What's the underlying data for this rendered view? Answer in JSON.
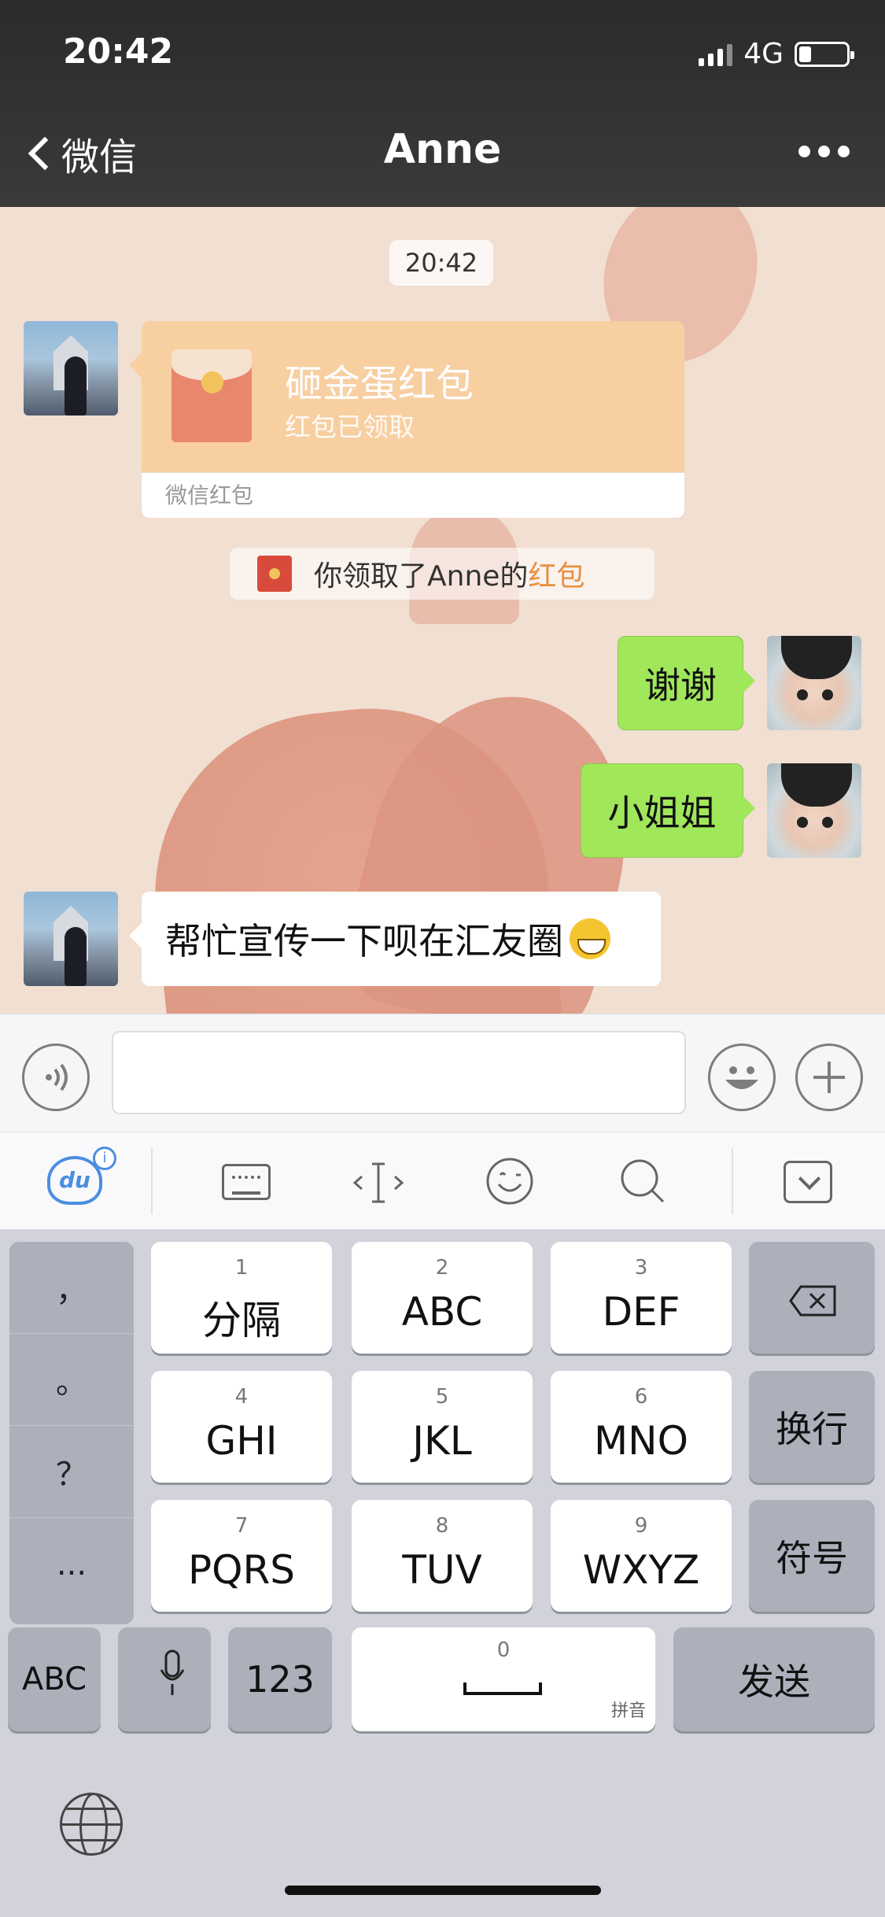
{
  "status_bar": {
    "time": "20:42",
    "network": "4G",
    "battery_level": 0.25
  },
  "nav": {
    "back_label": "微信",
    "title": "Anne"
  },
  "chat": {
    "timestamp": "20:42",
    "red_packet": {
      "title": "砸金蛋红包",
      "status": "红包已领取",
      "footer": "微信红包"
    },
    "system_notice": {
      "text": "你领取了Anne的",
      "link": "红包"
    },
    "messages": [
      {
        "side": "right",
        "text": "谢谢"
      },
      {
        "side": "right",
        "text": "小姐姐"
      },
      {
        "side": "left",
        "text": "帮忙宣传一下呗在汇友圈",
        "emoji": "grinning-face"
      }
    ]
  },
  "toolbar": {
    "ime_logo": "du",
    "ime_badge": "i"
  },
  "keyboard": {
    "punctuation": [
      "，",
      "。",
      "？",
      "..."
    ],
    "keys": [
      {
        "num": "1",
        "label": "分隔"
      },
      {
        "num": "2",
        "label": "ABC"
      },
      {
        "num": "3",
        "label": "DEF"
      },
      {
        "num": "4",
        "label": "GHI"
      },
      {
        "num": "5",
        "label": "JKL"
      },
      {
        "num": "6",
        "label": "MNO"
      },
      {
        "num": "7",
        "label": "PQRS"
      },
      {
        "num": "8",
        "label": "TUV"
      },
      {
        "num": "9",
        "label": "WXYZ"
      }
    ],
    "newline_label": "换行",
    "symbol_label": "符号",
    "abc_label": "ABC",
    "num_label": "123",
    "space_num": "0",
    "space_hint": "拼音",
    "send_label": "发送"
  }
}
